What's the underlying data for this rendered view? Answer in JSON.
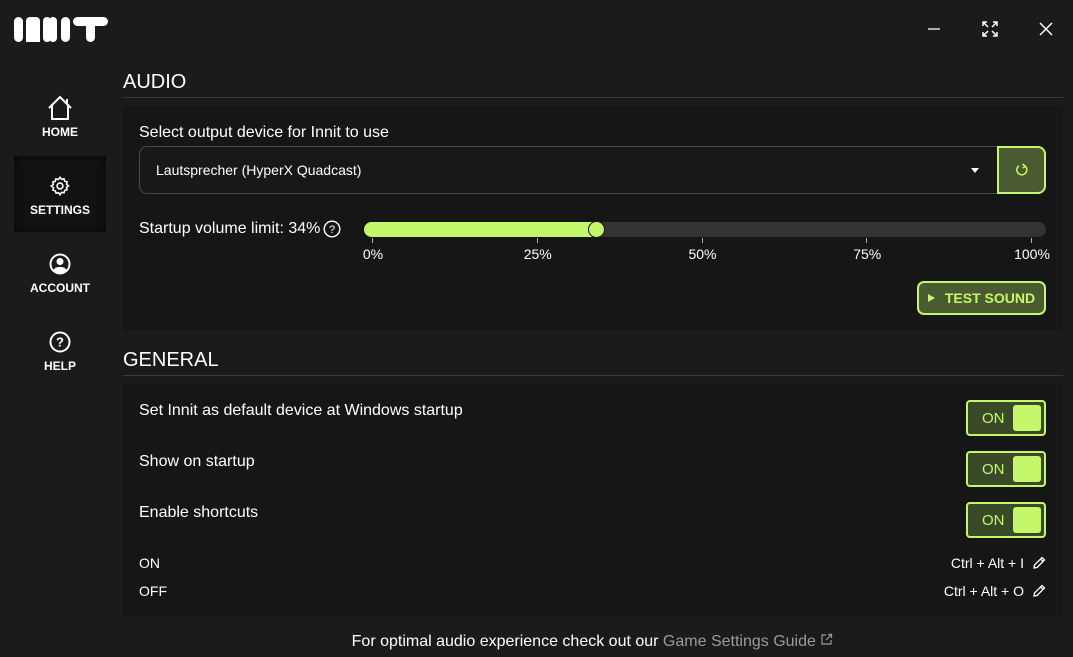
{
  "app": {
    "logo_text": "INNIT",
    "window_controls": [
      {
        "name": "minimize",
        "icon": "minimize-icon"
      },
      {
        "name": "maximize",
        "icon": "expand-icon"
      },
      {
        "name": "close",
        "icon": "close-icon"
      }
    ]
  },
  "sidebar": {
    "items": [
      {
        "label": "HOME",
        "icon": "home-icon",
        "active": false
      },
      {
        "label": "SETTINGS",
        "icon": "gear-icon",
        "active": true
      },
      {
        "label": "ACCOUNT",
        "icon": "user-icon",
        "active": false
      },
      {
        "label": "HELP",
        "icon": "help-icon",
        "active": false
      }
    ]
  },
  "audio": {
    "title": "AUDIO",
    "output_label": "Select output device for Innit to use",
    "output_device": "Lautsprecher (HyperX Quadcast)",
    "volume_label": "Startup volume limit: 34%",
    "volume_value": 34,
    "ticks": [
      "0%",
      "25%",
      "50%",
      "75%",
      "100%"
    ],
    "test_sound_label": "TEST SOUND"
  },
  "general": {
    "title": "GENERAL",
    "settings": [
      {
        "label": "Set Innit as default device at Windows startup",
        "state": "ON"
      },
      {
        "label": "Show on startup",
        "state": "ON"
      },
      {
        "label": "Enable shortcuts",
        "state": "ON"
      }
    ],
    "shortcuts": [
      {
        "label": "ON",
        "keys": "Ctrl + Alt + I"
      },
      {
        "label": "OFF",
        "keys": "Ctrl + Alt + O"
      }
    ]
  },
  "footer": {
    "text": "For optimal audio experience check out our ",
    "link": "Game Settings Guide"
  },
  "colors": {
    "accent": "#c4f76a",
    "accent_bg": "#4b5b31",
    "background": "#1b1b1b",
    "panel": "#161616"
  }
}
